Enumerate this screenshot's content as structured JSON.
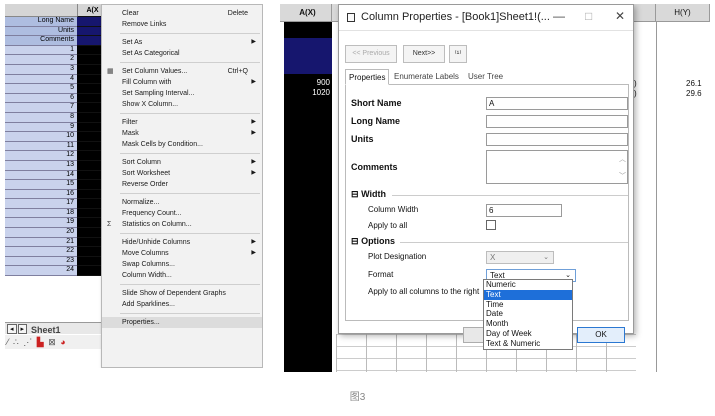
{
  "left": {
    "col_header": "A(X",
    "row_labels": [
      "Long Name",
      "Units",
      "Comments"
    ],
    "row_numbers": [
      "1",
      "2",
      "3",
      "4",
      "5",
      "6",
      "7",
      "8",
      "9",
      "10",
      "11",
      "12",
      "13",
      "14",
      "15",
      "16",
      "17",
      "18",
      "19",
      "20",
      "21",
      "22",
      "23",
      "24"
    ],
    "sheet_tab": "Sheet1",
    "menu": {
      "items": [
        {
          "label": "Clear",
          "shortcut": "Delete"
        },
        {
          "label": "Remove Links"
        },
        {
          "sep": true
        },
        {
          "label": "Set As",
          "submenu": true
        },
        {
          "label": "Set As Categorical"
        },
        {
          "sep": true
        },
        {
          "label": "Set Column Values...",
          "shortcut": "Ctrl+Q",
          "icon": "set-values-icon"
        },
        {
          "label": "Fill Column with",
          "submenu": true
        },
        {
          "label": "Set Sampling Interval..."
        },
        {
          "label": "Show X Column..."
        },
        {
          "sep": true
        },
        {
          "label": "Filter",
          "submenu": true
        },
        {
          "label": "Mask",
          "submenu": true
        },
        {
          "label": "Mask Cells by Condition..."
        },
        {
          "sep": true
        },
        {
          "label": "Sort Column",
          "submenu": true
        },
        {
          "label": "Sort Worksheet",
          "submenu": true
        },
        {
          "label": "Reverse Order"
        },
        {
          "sep": true
        },
        {
          "label": "Normalize..."
        },
        {
          "label": "Frequency Count..."
        },
        {
          "label": "Statistics on Column...",
          "icon": "statistics-icon"
        },
        {
          "sep": true
        },
        {
          "label": "Hide/Unhide Columns",
          "submenu": true
        },
        {
          "label": "Move Columns",
          "submenu": true
        },
        {
          "label": "Swap Columns..."
        },
        {
          "label": "Column Width..."
        },
        {
          "sep": true
        },
        {
          "label": "Slide Show of Dependent Graphs"
        },
        {
          "label": "Add Sparklines..."
        },
        {
          "sep": true
        },
        {
          "label": "Properties...",
          "highlight": true
        }
      ]
    }
  },
  "right": {
    "col_a_header": "A(X)",
    "col_h_header": "H(Y)",
    "col_a_values": [
      "900",
      "1020"
    ],
    "col_h_values": [
      "26.1",
      "29.6"
    ],
    "dialog": {
      "title": "Column Properties - [Book1]Sheet1!(...",
      "minimize": "—",
      "maximize": "□",
      "close": "✕",
      "prev_button": "<< Previous",
      "next_button": "Next>>",
      "tabs": [
        "Properties",
        "Enumerate Labels",
        "User Tree"
      ],
      "short_name_label": "Short Name",
      "short_name_value": "A",
      "long_name_label": "Long Name",
      "long_name_value": "",
      "units_label": "Units",
      "units_value": "",
      "comments_label": "Comments",
      "comments_value": "",
      "width_section": "Width",
      "column_width_label": "Column Width",
      "column_width_value": "6",
      "apply_to_all_label": "Apply to all",
      "options_section": "Options",
      "plot_designation_label": "Plot Designation",
      "plot_designation_value": "X",
      "format_label": "Format",
      "format_value": "Text",
      "apply_right_label": "Apply to all columns to the right",
      "format_options": [
        "Numeric",
        "Text",
        "Time",
        "Date",
        "Month",
        "Day of Week",
        "Text & Numeric"
      ],
      "format_selected_index": 1,
      "ok_button": "OK"
    }
  },
  "caption": "图3"
}
